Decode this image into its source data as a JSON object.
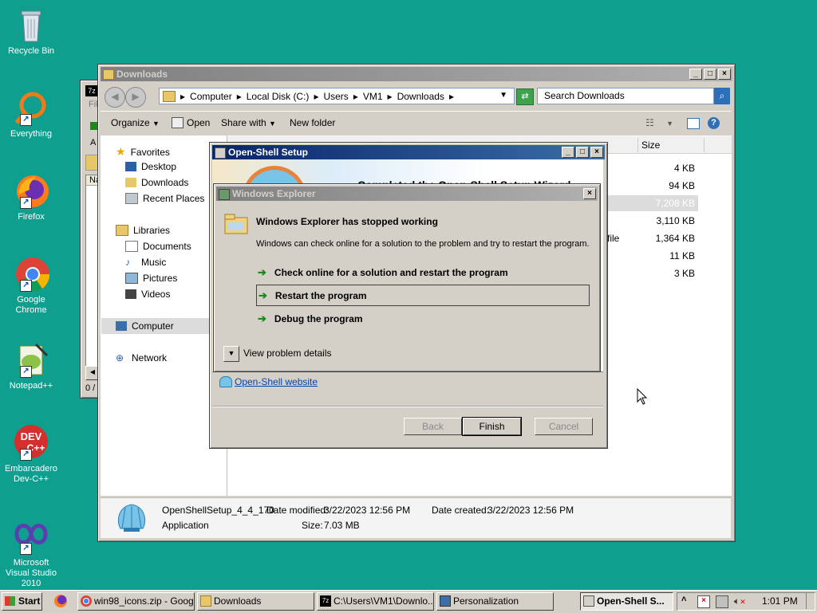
{
  "desktop": {
    "icons": [
      {
        "label": "Recycle Bin"
      },
      {
        "label": "Everything"
      },
      {
        "label": "Firefox"
      },
      {
        "label": "Google Chrome"
      },
      {
        "label": "Notepad++"
      },
      {
        "label": "Embarcadero Dev-C++"
      },
      {
        "label": "Microsoft Visual Studio 2010"
      }
    ]
  },
  "bg_window": {
    "menu_prefix": "File",
    "col_prefix": "Na",
    "status": "0 /",
    "a": "A"
  },
  "explorer": {
    "title": "Downloads",
    "breadcrumb": [
      "Computer",
      "Local Disk (C:)",
      "Users",
      "VM1",
      "Downloads"
    ],
    "search_placeholder": "Search Downloads",
    "toolbar": {
      "organize": "Organize",
      "open": "Open",
      "share": "Share with",
      "new_folder": "New folder"
    },
    "nav": {
      "favorites": "Favorites",
      "desktop": "Desktop",
      "downloads": "Downloads",
      "recent": "Recent Places",
      "libraries": "Libraries",
      "documents": "Documents",
      "music": "Music",
      "pictures": "Pictures",
      "videos": "Videos",
      "computer": "Computer",
      "network": "Network"
    },
    "columns": {
      "size": "Size"
    },
    "sizes": [
      "4 KB",
      "94 KB",
      "7,208 KB",
      "3,110 KB",
      "1,364 KB",
      "11 KB",
      "3 KB"
    ],
    "type_fragment": "file",
    "details": {
      "name": "OpenShellSetup_4_4_170",
      "type": "Application",
      "date_modified_label": "Date modified:",
      "date_modified": "3/22/2023 12:56 PM",
      "size_label": "Size:",
      "size": "7.03 MB",
      "date_created_label": "Date created:",
      "date_created": "3/22/2023 12:56 PM"
    }
  },
  "setup": {
    "title": "Open-Shell Setup",
    "banner_text": "Completed the Open-Shell Setup Wizard",
    "website_link": "Open-Shell website",
    "back": "Back",
    "finish": "Finish",
    "cancel": "Cancel"
  },
  "error_dialog": {
    "title": "Windows Explorer",
    "heading": "Windows Explorer has stopped working",
    "message": "Windows can check online for a solution to the problem and try to restart the program.",
    "options": [
      "Check online for a solution and restart the program",
      "Restart the program",
      "Debug the program"
    ],
    "details": "View problem details"
  },
  "taskbar": {
    "start": "Start",
    "items": [
      "win98_icons.zip - Googl...",
      "Downloads",
      "C:\\Users\\VM1\\Downlo...",
      "Personalization",
      "Open-Shell S..."
    ],
    "clock": "1:01 PM"
  }
}
